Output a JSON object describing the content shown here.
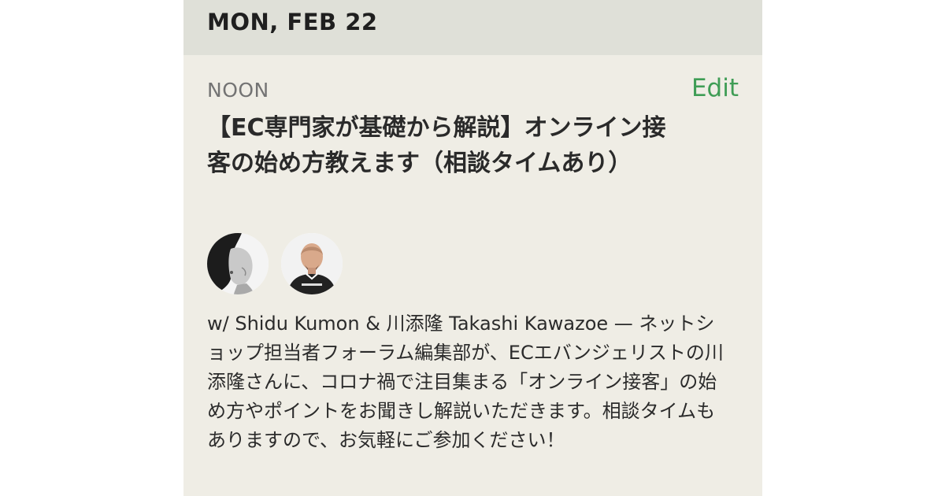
{
  "date_header": "MON, FEB 22",
  "event": {
    "time_label": "NOON",
    "edit_label": "Edit",
    "title": "【EC専門家が基礎から解説】オンライン接客の始め方教えます（相談タイムあり）",
    "hosts": [
      {
        "name": "Shidu Kumon"
      },
      {
        "name": "川添隆 Takashi Kawazoe"
      }
    ],
    "description": "w/ Shidu Kumon & 川添隆 Takashi Kawazoe — ネットショップ担当者フォーラム編集部が、ECエバンジェリストの川添隆さんに、コロナ禍で注目集まる「オンライン接客」の始め方やポイントをお聞きし解説いただきます。相談タイムもありますので、お気軽にご参加ください！"
  },
  "colors": {
    "header_bg": "#dfe0d8",
    "card_bg": "#efede5",
    "edit_accent": "#3f9d55"
  },
  "icons": {
    "avatar_1": "host-photo-woman",
    "avatar_2": "host-photo-man"
  }
}
